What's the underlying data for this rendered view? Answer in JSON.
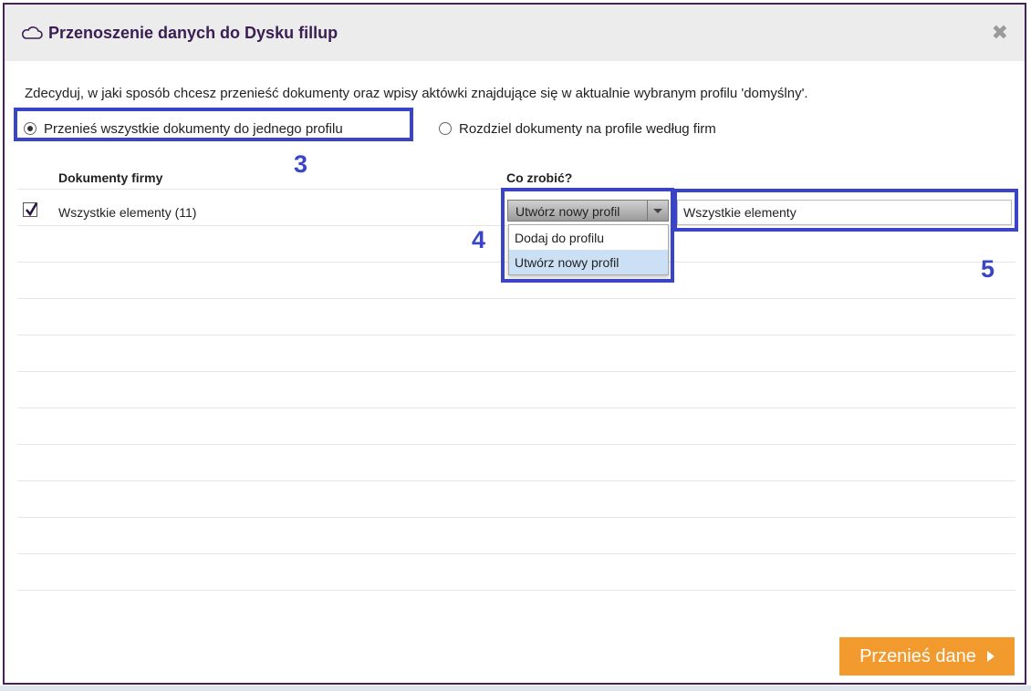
{
  "dialog": {
    "title": "Przenoszenie danych do Dysku fillup",
    "title_icon": "cloud-icon",
    "close_glyph": "✖"
  },
  "intro_text": "Zdecyduj, w jaki sposób chcesz przenieść dokumenty oraz wpisy aktówki znajdujące się w aktualnie wybranym profilu 'domyślny'.",
  "options": {
    "single_profile": {
      "label": "Przenieś wszystkie dokumenty do jednego profilu",
      "selected": true
    },
    "split_profiles": {
      "label": "Rozdziel dokumenty na profile według firm",
      "selected": false
    }
  },
  "table": {
    "col_documents": "Dokumenty firmy",
    "col_action": "Co zrobić?",
    "rows": [
      {
        "checked": true,
        "label": "Wszystkie elementy (11)"
      }
    ]
  },
  "action_select": {
    "value": "Utwórz nowy profil",
    "options": [
      "Dodaj do profilu",
      "Utwórz nowy profil"
    ],
    "highlighted_option": "Utwórz nowy profil"
  },
  "profile_name_input": {
    "value": "Wszystkie elementy"
  },
  "annotations": {
    "a3": "3",
    "a4": "4",
    "a5": "5",
    "color": "#3a44c6"
  },
  "submit_button": {
    "label": "Przenieś dane",
    "color": "#f39a2e"
  }
}
